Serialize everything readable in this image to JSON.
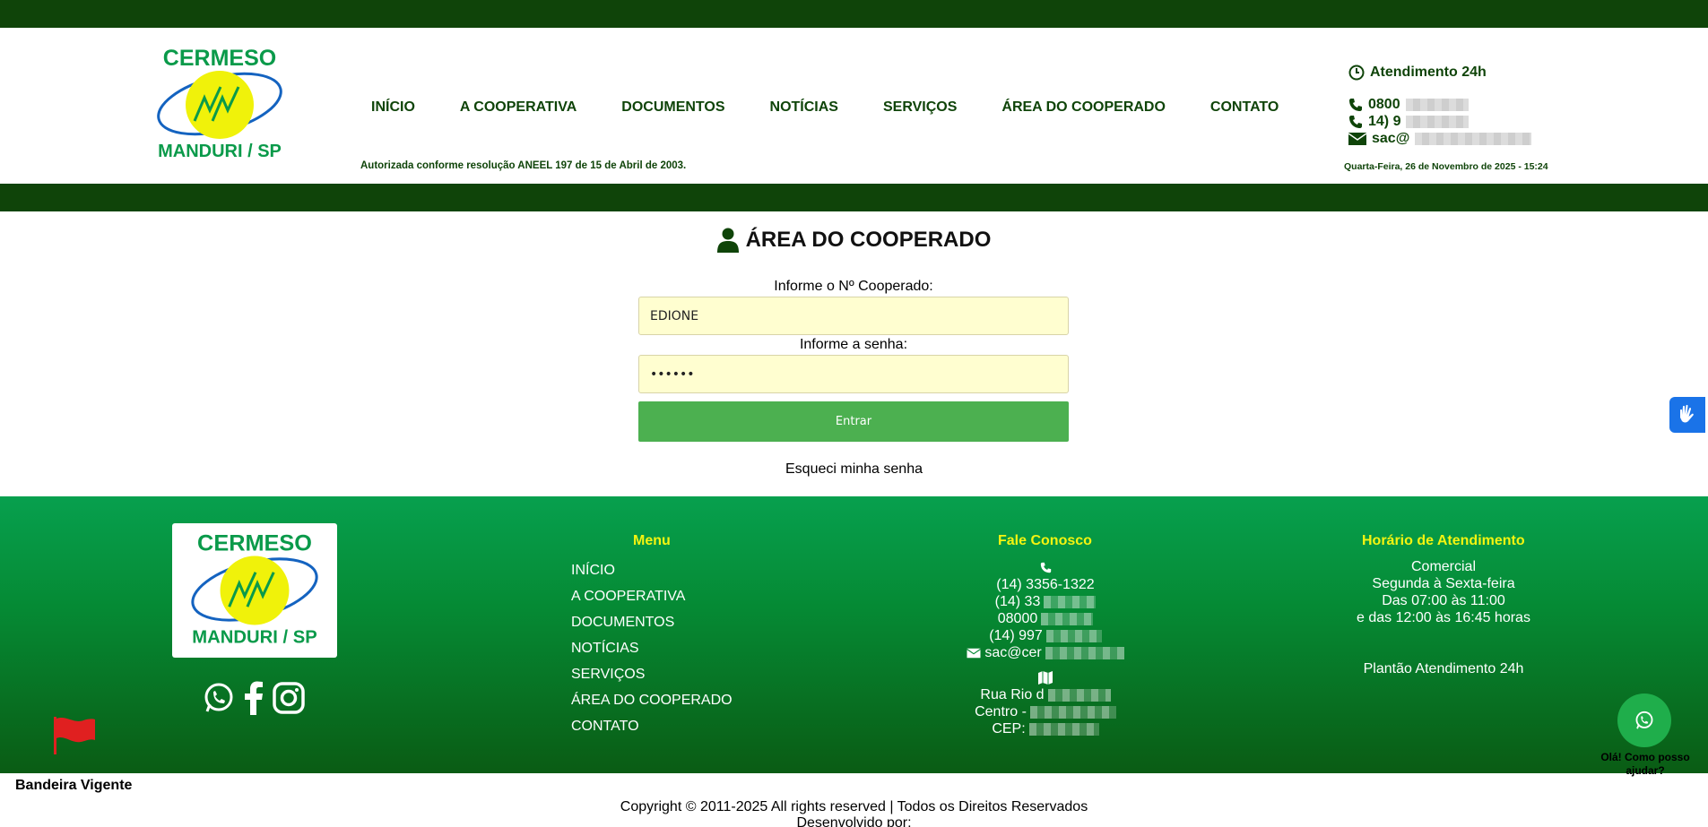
{
  "logo": {
    "line1": "CERMESO",
    "line2": "MANDURI / SP"
  },
  "nav": [
    {
      "label": "INÍCIO"
    },
    {
      "label": "A COOPERATIVA"
    },
    {
      "label": "DOCUMENTOS"
    },
    {
      "label": "NOTÍCIAS"
    },
    {
      "label": "SERVIÇOS"
    },
    {
      "label": "ÁREA DO COOPERADO"
    },
    {
      "label": "CONTATO"
    }
  ],
  "header": {
    "aneel": "Autorizada conforme resolução ANEEL 197 de 15 de Abril de 2003.",
    "atendimento": "Atendimento 24h",
    "phone1": "0800",
    "phone2": "14) 9",
    "email": "sac@",
    "date": "Quarta-Feira, 26 de Novembro de 2025 - 15:24"
  },
  "main": {
    "title": "ÁREA DO COOPERADO",
    "cooperado_label": "Informe o Nº Cooperado:",
    "cooperado_value": "EDIONE",
    "senha_label": "Informe a senha:",
    "senha_value": "••••••",
    "enter_label": "Entrar",
    "forgot": "Esqueci minha senha"
  },
  "footer": {
    "menu_title": "Menu",
    "menu": [
      "INÍCIO",
      "A COOPERATIVA",
      "DOCUMENTOS",
      "NOTÍCIAS",
      "SERVIÇOS",
      "ÁREA DO COOPERADO",
      "CONTATO"
    ],
    "fale_title": "Fale Conosco",
    "fale_lines": [
      "(14) 3356-1322",
      "(14) 33",
      "08000",
      "(14) 997",
      "sac@cer"
    ],
    "address_lines": [
      "Rua Rio d",
      "Centro -",
      "CEP:"
    ],
    "horario_title": "Horário de Atendimento",
    "horario_lines": [
      "Comercial",
      "Segunda à Sexta-feira",
      "Das 07:00 às 11:00",
      "e das 12:00 às 16:45 horas"
    ],
    "plantao": "Plantão Atendimento 24h"
  },
  "bandeira": "Bandeira Vigente",
  "copyright": "Copyright © 2011-2025 All rights reserved | Todos os Direitos Reservados",
  "devby": "Desenvolvido por:",
  "whatsapp_text": "Olá! Como posso ajudar?",
  "colors": {
    "dark_green": "#0f4409",
    "green_button": "#4cb050",
    "yellow": "#f4f410",
    "input_bg": "#fffed0"
  }
}
